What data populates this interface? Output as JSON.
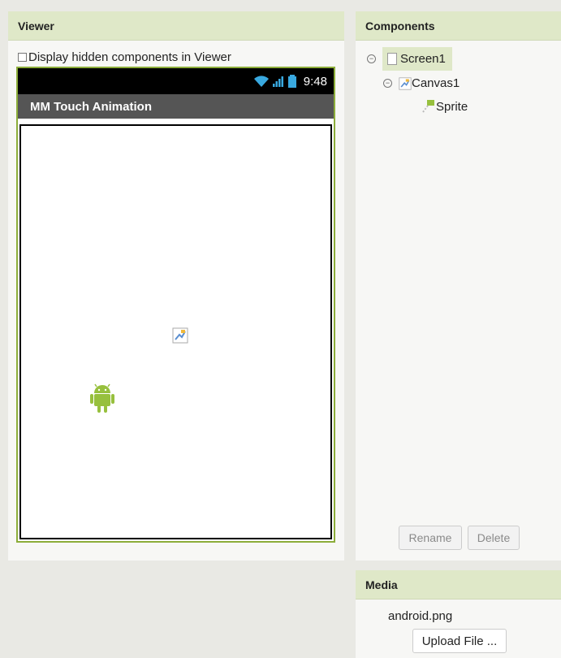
{
  "viewer": {
    "title": "Viewer",
    "hidden_label": "Display hidden components in Viewer",
    "phone": {
      "time": "9:48",
      "app_title": "MM Touch Animation"
    }
  },
  "components": {
    "title": "Components",
    "tree": {
      "screen": "Screen1",
      "canvas": "Canvas1",
      "sprite": "Sprite"
    },
    "rename_label": "Rename",
    "delete_label": "Delete"
  },
  "media": {
    "title": "Media",
    "file": "android.png",
    "upload_label": "Upload File ..."
  },
  "colors": {
    "header_bg": "#dfe8c8",
    "phone_border": "#8cad3a",
    "android_green": "#97c03d"
  }
}
